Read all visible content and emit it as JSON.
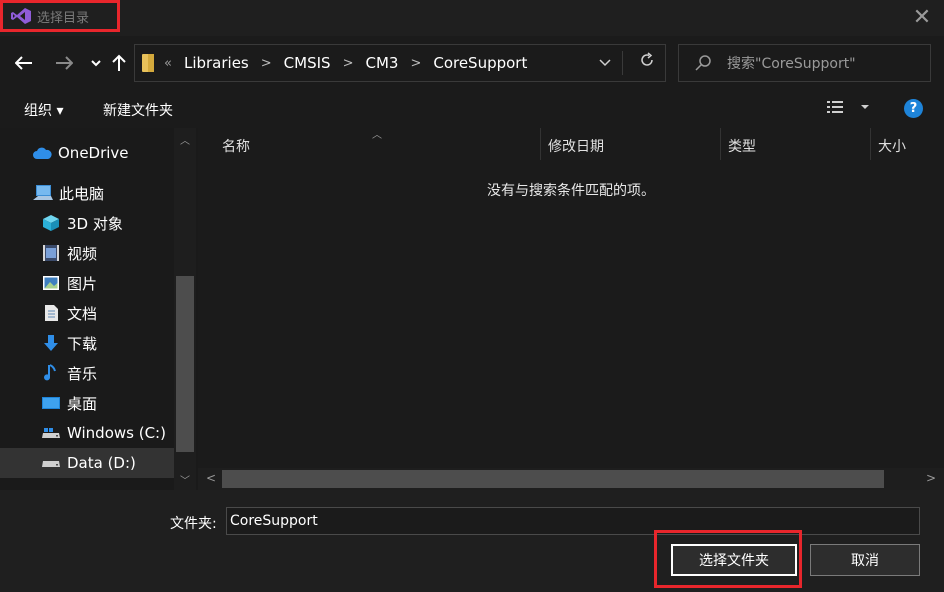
{
  "window": {
    "title": "选择目录",
    "close_glyph": "✕"
  },
  "navigation": {
    "address": {
      "crumbs": [
        "Libraries",
        "CMSIS",
        "CM3",
        "CoreSupport"
      ]
    },
    "search": {
      "placeholder": "搜索\"CoreSupport\""
    }
  },
  "toolbar": {
    "organize_label": "组织 ▾",
    "new_folder_label": "新建文件夹",
    "help_label": "?"
  },
  "sidebar": {
    "items": [
      {
        "label": "OneDrive",
        "icon": "cloud-icon"
      },
      {
        "label": "此电脑",
        "icon": "computer-icon"
      },
      {
        "label": "3D 对象",
        "icon": "cube-icon"
      },
      {
        "label": "视频",
        "icon": "video-icon"
      },
      {
        "label": "图片",
        "icon": "picture-icon"
      },
      {
        "label": "文档",
        "icon": "document-icon"
      },
      {
        "label": "下载",
        "icon": "download-icon"
      },
      {
        "label": "音乐",
        "icon": "music-icon"
      },
      {
        "label": "桌面",
        "icon": "desktop-icon"
      },
      {
        "label": "Windows (C:)",
        "icon": "drive-icon"
      },
      {
        "label": "Data (D:)",
        "icon": "drive-icon",
        "selected": true
      }
    ]
  },
  "file_list": {
    "columns": [
      "名称",
      "修改日期",
      "类型",
      "大小"
    ],
    "empty_message": "没有与搜索条件匹配的项。"
  },
  "footer": {
    "folder_label": "文件夹:",
    "folder_value": "CoreSupport",
    "select_button": "选择文件夹",
    "cancel_button": "取消"
  },
  "colors": {
    "accent": "#1e84d9",
    "highlight_box": "#e8262c",
    "background": "#1b1b1b",
    "vs_icon": "#8f5cd8"
  }
}
